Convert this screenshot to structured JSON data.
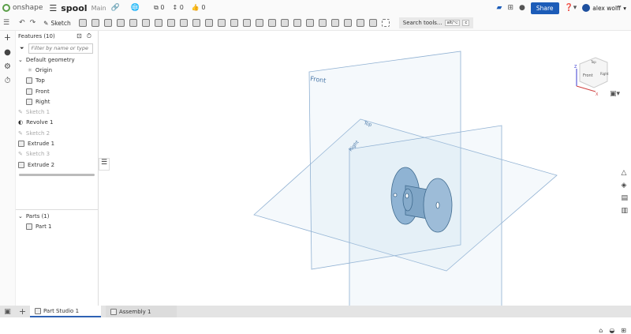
{
  "header": {
    "brand": "onshape",
    "title": "spool",
    "branch": "Main",
    "counts": {
      "versions": "0",
      "branches": "0",
      "likes": "0"
    },
    "share_label": "Share",
    "user": "alex wolff",
    "colors": {
      "brand": "#5a9e48",
      "share": "#1c5cb8"
    }
  },
  "toolbar": {
    "sketch_label": "Sketch",
    "search_label": "Search tools...",
    "shortcut_keys": [
      "alt/⌥",
      "c"
    ]
  },
  "features": {
    "header": "Features (10)",
    "filter_placeholder": "Filter by name or type",
    "default_geometry": "Default geometry",
    "geometry_items": [
      {
        "label": "Origin",
        "icon": "point-icon"
      },
      {
        "label": "Top",
        "icon": "plane-icon"
      },
      {
        "label": "Front",
        "icon": "plane-icon"
      },
      {
        "label": "Right",
        "icon": "plane-icon"
      }
    ],
    "items": [
      {
        "label": "Sketch 1",
        "icon": "sketch-icon",
        "suppressed": true
      },
      {
        "label": "Revolve 1",
        "icon": "revolve-icon",
        "suppressed": false
      },
      {
        "label": "Sketch 2",
        "icon": "sketch-icon",
        "suppressed": true
      },
      {
        "label": "Extrude 1",
        "icon": "extrude-icon",
        "suppressed": false
      },
      {
        "label": "Sketch 3",
        "icon": "sketch-icon",
        "suppressed": true
      },
      {
        "label": "Extrude 2",
        "icon": "extrude-icon",
        "suppressed": false
      }
    ]
  },
  "parts": {
    "header": "Parts (1)",
    "items": [
      "Part 1"
    ]
  },
  "viewport": {
    "plane_labels": {
      "front": "Front",
      "top": "Top",
      "right": "Right"
    },
    "cube": {
      "top": "Top",
      "front": "Front",
      "right": "Right",
      "z": "Z",
      "x": "X"
    }
  },
  "tabs": [
    {
      "label": "Part Studio 1",
      "active": true
    },
    {
      "label": "Assembly 1",
      "active": false
    }
  ]
}
